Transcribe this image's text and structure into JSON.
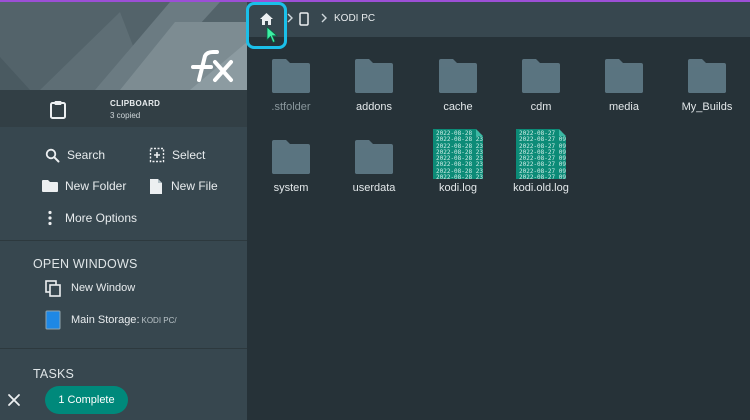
{
  "clipboard": {
    "title": "CLIPBOARD",
    "subtitle": "3 copied"
  },
  "actions": {
    "search": "Search",
    "select": "Select",
    "new_folder": "New Folder",
    "new_file": "New File",
    "more_options": "More Options"
  },
  "open_windows": {
    "title": "OPEN WINDOWS",
    "new_window": "New Window",
    "main_storage": "Main Storage",
    "main_storage_path": "KODI PC/"
  },
  "tasks": {
    "title": "TASKS",
    "status": "1 Complete"
  },
  "breadcrumb": {
    "device": "KODI PC"
  },
  "files": [
    {
      "name": ".stfolder",
      "type": "folder",
      "faded": true
    },
    {
      "name": "addons",
      "type": "folder"
    },
    {
      "name": "cache",
      "type": "folder"
    },
    {
      "name": "cdm",
      "type": "folder"
    },
    {
      "name": "media",
      "type": "folder"
    },
    {
      "name": "My_Builds",
      "type": "folder"
    },
    {
      "name": "system",
      "type": "folder"
    },
    {
      "name": "userdata",
      "type": "folder"
    },
    {
      "name": "kodi.log",
      "type": "log"
    },
    {
      "name": "kodi.old.log",
      "type": "log"
    }
  ],
  "log_preview": {
    "kodi_log": [
      "2022-08-28 23",
      "2022-08-28 23",
      "2022-08-28 23",
      "2022-08-28 23",
      "2022-08-28 23",
      "2022-08-28 23",
      "2022-08-28 23",
      "2022-08-28 23"
    ],
    "kodi_old_log": [
      "2022-08-27 09",
      "2022-08-27 09",
      "2022-08-27 09",
      "2022-08-27 09",
      "2022-08-27 09",
      "2022-08-27 09",
      "2022-08-27 09",
      "2022-08-27 09"
    ]
  },
  "colors": {
    "accent": "#1bbfe9",
    "teal": "#00897b",
    "background": "#263238",
    "sidebar": "#37474f",
    "folder": "#5b7480"
  }
}
